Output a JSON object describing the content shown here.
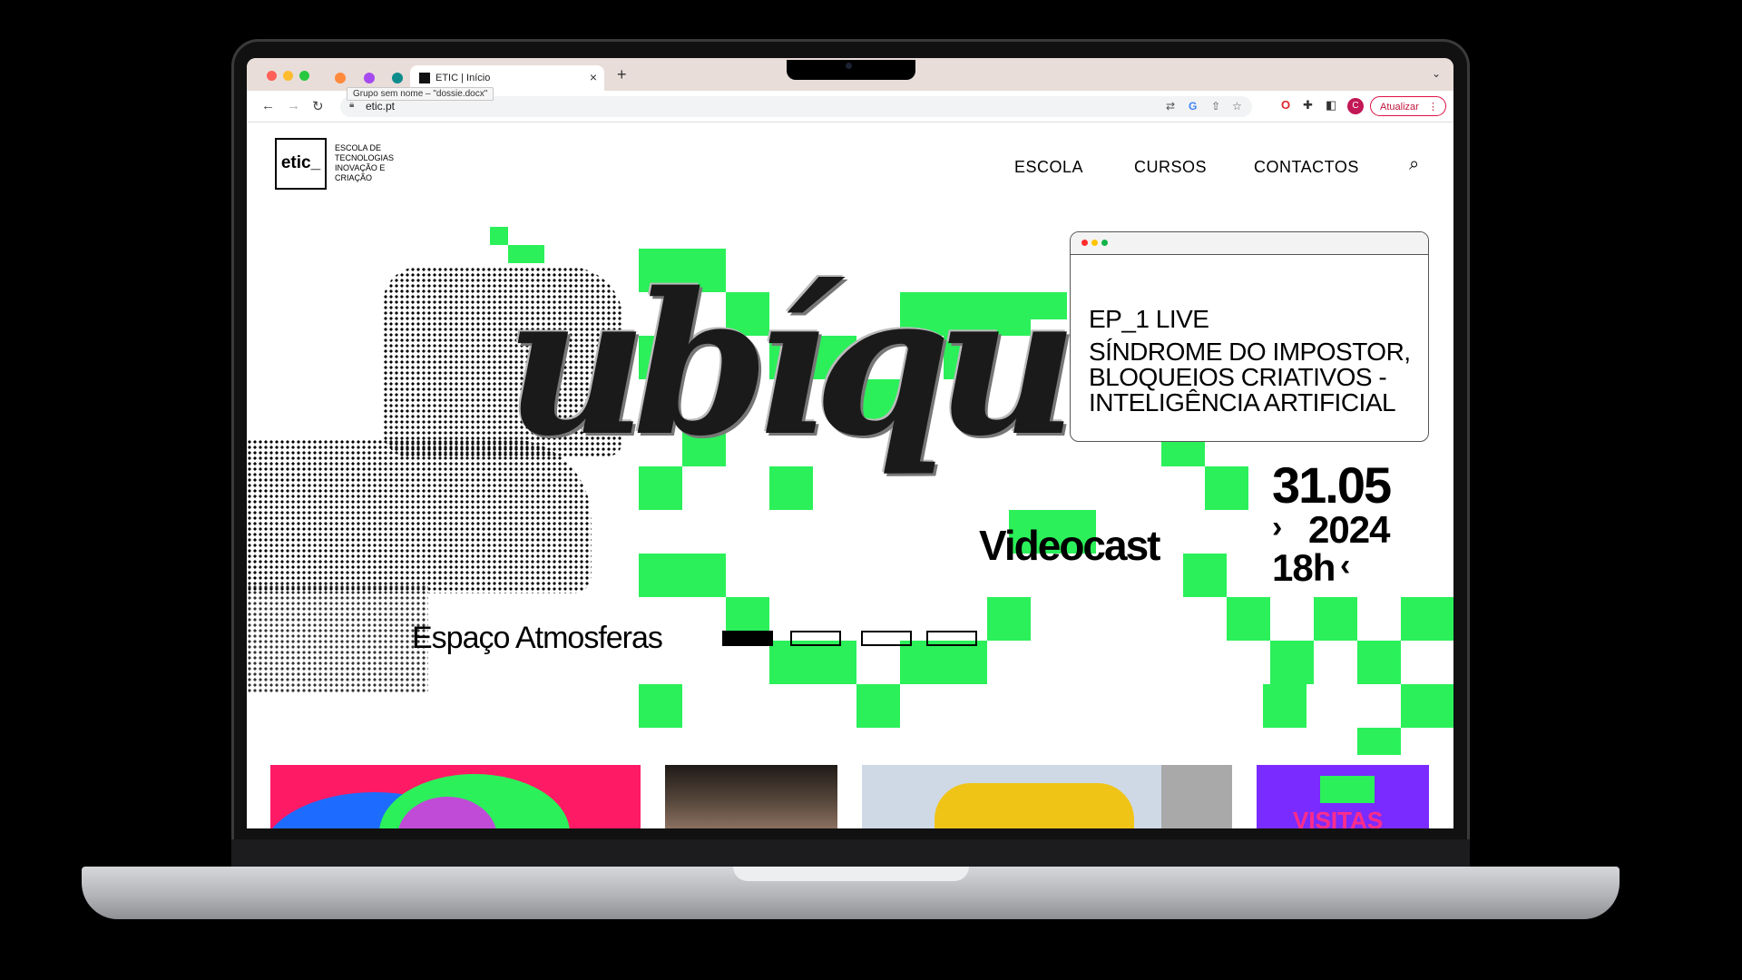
{
  "browser": {
    "tab_title": "ETIC | Início",
    "tooltip": "Grupo sem nome – \"dossie.docx\"",
    "url": "etic.pt",
    "avatar_letter": "C",
    "update_label": "Atualizar",
    "new_tab_symbol": "+",
    "tab_close_symbol": "×",
    "menu_symbol": "⋮"
  },
  "site": {
    "logo_text": "etic_",
    "tagline": "ESCOLA DE TECNOLOGIAS INOVAÇÃO E CRIAÇÃO",
    "nav": [
      "ESCOLA",
      "CURSOS",
      "CONTACTOS"
    ]
  },
  "hero": {
    "word": "ubíqu",
    "subtitle": "Videocast",
    "episode": "EP_1 LIVE",
    "topic": "SÍNDROME DO IMPOSTOR, BLOQUEIOS CRIATIVOS - INTELIGÊNCIA ARTIFICIAL",
    "date_day": "31.05",
    "date_year": "2024",
    "time": "18h",
    "location": "Espaço Atmosferas",
    "slides_total": 4,
    "slide_active": 1
  },
  "cards": {
    "visitas_label": "VISITAS"
  },
  "colors": {
    "accent_green": "#2bf05a",
    "update_red": "#c0163d",
    "card_pink": "#ff1a66",
    "card_purple": "#7a2bff"
  }
}
